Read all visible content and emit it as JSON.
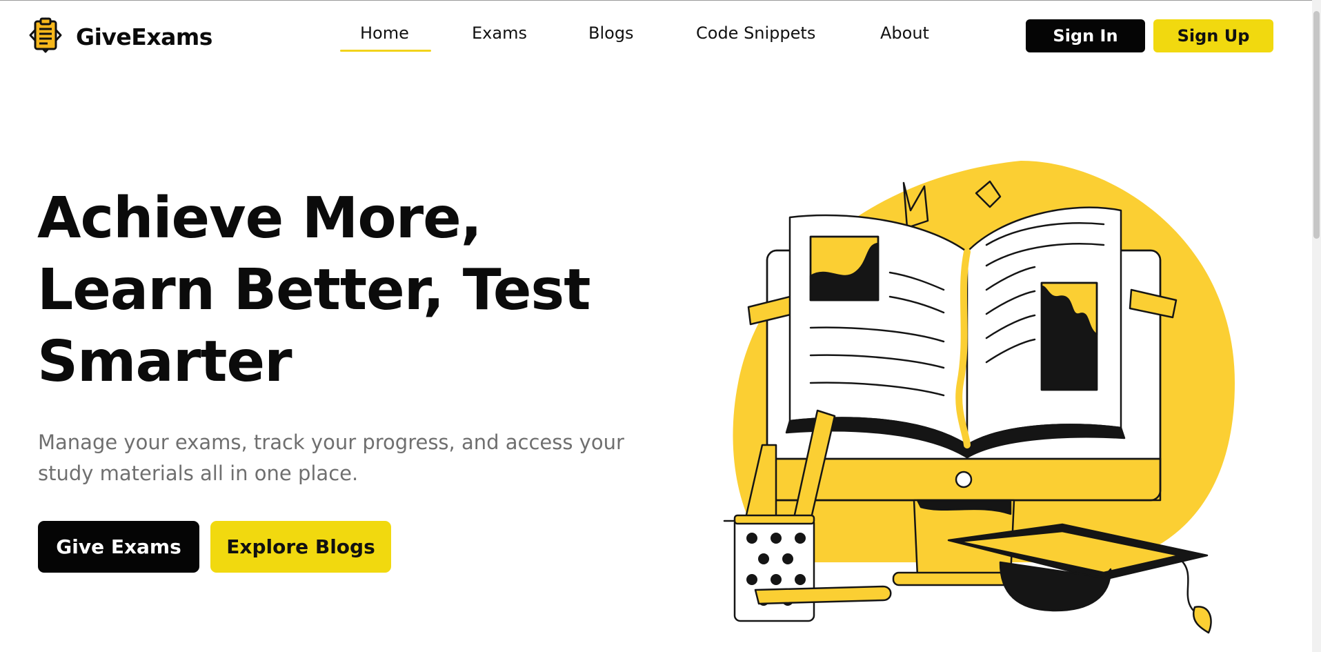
{
  "brand": {
    "name": "GiveExams",
    "logo_icon": "clipboard-icon"
  },
  "nav": {
    "items": [
      {
        "label": "Home",
        "active": true
      },
      {
        "label": "Exams"
      },
      {
        "label": "Blogs"
      },
      {
        "label": "Code Snippets"
      },
      {
        "label": "About"
      }
    ]
  },
  "auth": {
    "signin_label": "Sign In",
    "signup_label": "Sign Up"
  },
  "hero": {
    "title_lines": [
      "Achieve More,",
      "Learn Better, Test",
      "Smarter"
    ],
    "subtitle_lines": [
      "Manage your exams, track your progress, and access your",
      "study materials all in one place."
    ],
    "primary_cta": "Give Exams",
    "secondary_cta": "Explore Blogs",
    "illustration": "book-computer-illustration"
  },
  "colors": {
    "accent": "#F1D90F",
    "illustration_yellow": "#FBCF33",
    "dark": "#050505",
    "muted_text": "#6F6F6F"
  }
}
